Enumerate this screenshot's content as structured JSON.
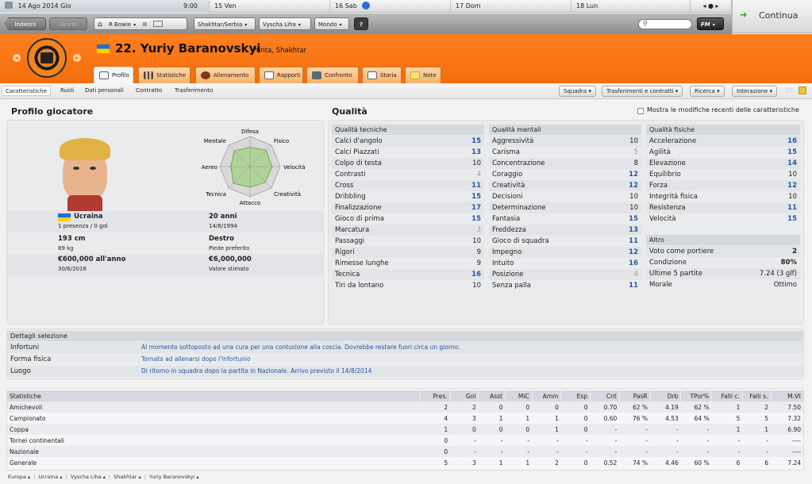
{
  "topbar": {
    "today": "14 Ago 2014  Gio",
    "time": "9:00",
    "days": [
      "15 Ven",
      "16 Sab",
      "17 Dom",
      "18 Lun"
    ],
    "continue_label": "Continua"
  },
  "nav": {
    "back": "Indietro",
    "forward": "Avanti",
    "manager": "R Bowie",
    "club": "Shakhtar/Serbia",
    "league": "Vyscha Liha",
    "world": "Mondo",
    "help": "?",
    "search_placeholder": "",
    "fm": "FM"
  },
  "player": {
    "title": "22. Yuriy Baranovskyi",
    "subtitle": "Punta, Shakhtar"
  },
  "tabs": [
    "Profilo",
    "Statistiche",
    "Allenamento",
    "Rapporti",
    "Confronto",
    "Storia",
    "Note"
  ],
  "subtabs": [
    "Caratteristiche",
    "Ruoli",
    "Dati personali",
    "Contratto",
    "Trasferimento"
  ],
  "dropdowns": [
    "Squadra",
    "Trasferimenti e contratti",
    "Ricerca",
    "Interazione"
  ],
  "profile": {
    "heading": "Profilo giocatore",
    "radar_labels": {
      "difesa": "Difesa",
      "fisico": "Fisico",
      "velocita": "Velocità",
      "creativita": "Creatività",
      "attacco": "Attacco",
      "tecnica": "Tecnica",
      "aereo": "Aereo",
      "mentale": "Mentale"
    },
    "nation": "Ucraina",
    "caps": "1 presenza / 0 gol",
    "age": "20 anni",
    "dob": "14/8/1994",
    "height": "193 cm",
    "weight": "89 kg",
    "foot": "Destro",
    "foot_label": "Piede preferito",
    "wage": "€600,000 all'anno",
    "contract_end": "30/6/2018",
    "value": "€6,000,000",
    "value_label": "Valore stimato"
  },
  "qualities": {
    "heading": "Qualità",
    "checkbox_label": "Mostra le modifiche recenti delle caratteristiche",
    "technical_title": "Qualità tecniche",
    "technical": [
      {
        "name": "Calci d'angolo",
        "value": "15"
      },
      {
        "name": "Calci Piazzati",
        "value": "13"
      },
      {
        "name": "Colpo di testa",
        "value": "10"
      },
      {
        "name": "Contrasti",
        "value": "4"
      },
      {
        "name": "Cross",
        "value": "11"
      },
      {
        "name": "Dribbling",
        "value": "15"
      },
      {
        "name": "Finalizzazione",
        "value": "17"
      },
      {
        "name": "Gioco di prima",
        "value": "15"
      },
      {
        "name": "Marcatura",
        "value": "3"
      },
      {
        "name": "Passaggi",
        "value": "10"
      },
      {
        "name": "Rigori",
        "value": "9"
      },
      {
        "name": "Rimesse lunghe",
        "value": "9"
      },
      {
        "name": "Tecnica",
        "value": "16"
      },
      {
        "name": "Tiri da lontano",
        "value": "10"
      }
    ],
    "mental_title": "Qualità mentali",
    "mental": [
      {
        "name": "Aggressività",
        "value": "10"
      },
      {
        "name": "Carisma",
        "value": "5"
      },
      {
        "name": "Concentrazione",
        "value": "8"
      },
      {
        "name": "Coraggio",
        "value": "12"
      },
      {
        "name": "Creatività",
        "value": "12"
      },
      {
        "name": "Decisioni",
        "value": "10"
      },
      {
        "name": "Determinazione",
        "value": "10"
      },
      {
        "name": "Fantasia",
        "value": "15"
      },
      {
        "name": "Freddezza",
        "value": "13"
      },
      {
        "name": "Gioco di squadra",
        "value": "11"
      },
      {
        "name": "Impegno",
        "value": "12"
      },
      {
        "name": "Intuito",
        "value": "16"
      },
      {
        "name": "Posizione",
        "value": "4"
      },
      {
        "name": "Senza palla",
        "value": "11"
      }
    ],
    "physical_title": "Qualità fisiche",
    "physical": [
      {
        "name": "Accelerazione",
        "value": "16"
      },
      {
        "name": "Agilità",
        "value": "15"
      },
      {
        "name": "Elevazione",
        "value": "14"
      },
      {
        "name": "Equilibrio",
        "value": "10"
      },
      {
        "name": "Forza",
        "value": "12"
      },
      {
        "name": "Integrità fisica",
        "value": "10"
      },
      {
        "name": "Resistenza",
        "value": "11"
      },
      {
        "name": "Velocità",
        "value": "15"
      }
    ],
    "other_title": "Altro",
    "other": [
      {
        "name": "Voto come portiere",
        "value": "2"
      },
      {
        "name": "Condizione",
        "value": "80%"
      },
      {
        "name": "Ultime 5 partite",
        "value": "7.24 (3 glf)"
      },
      {
        "name": "Morale",
        "value": "Ottimo"
      }
    ]
  },
  "details": {
    "title": "Dettagli selezione",
    "rows": [
      {
        "label": "Infortuni",
        "text": "Al momento sottoposto ad una cura per una contusione alla coscia. Dovrebbe restare fuori circa un giorno."
      },
      {
        "label": "Forma fisica",
        "text": "Tornato ad allenarsi dopo l'infortunio"
      },
      {
        "label": "Luogo",
        "text": "Di ritorno in squadra dopo la partita in Nazionale. Arrivo previsto il 14/8/2014"
      }
    ]
  },
  "stats": {
    "columns": [
      "Statistiche",
      "Pres.",
      "Gol",
      "Asst",
      "MiC",
      "Amm",
      "Esp",
      "Cnt",
      "PasR",
      "Drb",
      "TPor%",
      "Falli c.",
      "Falli s.",
      "M.Vt"
    ],
    "rows": [
      [
        "Amichevoli",
        "2",
        "2",
        "0",
        "0",
        "0",
        "0",
        "0.70",
        "62 %",
        "4.19",
        "62 %",
        "1",
        "2",
        "7.50"
      ],
      [
        "Campionato",
        "4",
        "3",
        "1",
        "1",
        "1",
        "0",
        "0.60",
        "76 %",
        "4.53",
        "64 %",
        "5",
        "5",
        "7.32"
      ],
      [
        "Coppa",
        "1",
        "0",
        "0",
        "0",
        "1",
        "0",
        "-",
        "-",
        "-",
        "-",
        "1",
        "1",
        "6.90"
      ],
      [
        "Tornei continentali",
        "0",
        "-",
        "-",
        "-",
        "-",
        "-",
        "-",
        "-",
        "-",
        "-",
        "-",
        "-",
        "----"
      ],
      [
        "Nazionale",
        "0",
        "-",
        "-",
        "-",
        "-",
        "-",
        "-",
        "-",
        "-",
        "-",
        "-",
        "-",
        "----"
      ],
      [
        "Generale",
        "5",
        "3",
        "1",
        "1",
        "2",
        "0",
        "0.52",
        "74 %",
        "4.46",
        "60 %",
        "6",
        "6",
        "7.24"
      ]
    ]
  },
  "breadcrumb": [
    "Europa",
    "Ucraina",
    "Vyscha Liha",
    "Shakhtar",
    "Yuriy Baranovskyi"
  ],
  "colors": {
    "accent": "#f47a1b",
    "high_value": "#2456a6",
    "panel": "#eaebec"
  }
}
